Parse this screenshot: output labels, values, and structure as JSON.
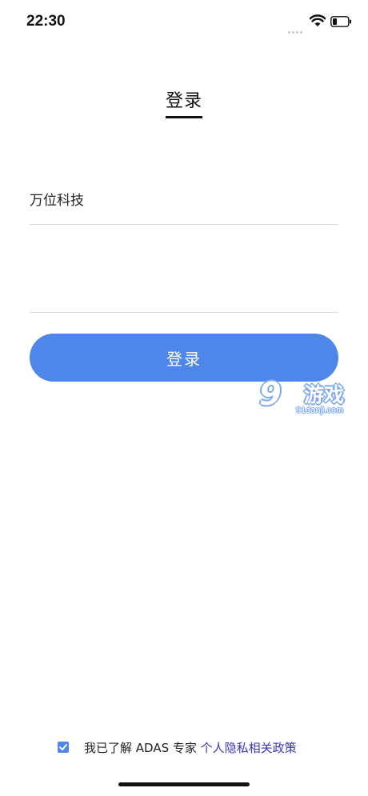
{
  "status_bar": {
    "time": "22:30",
    "icons": [
      "signal-icon",
      "wifi-icon",
      "battery-icon"
    ]
  },
  "header": {
    "title": "登录"
  },
  "form": {
    "company_value": "万位科技",
    "second_value": "",
    "login_label": "登录"
  },
  "watermark": {
    "nine": "9",
    "text": "游戏",
    "url": "91danji.com"
  },
  "agreement": {
    "checked": true,
    "text": "我已了解 ADAS 专家 ",
    "link": "个人隐私相关政策"
  },
  "colors": {
    "accent": "#4f86ea",
    "link": "#3a36b8",
    "divider": "#d9d9d9"
  }
}
